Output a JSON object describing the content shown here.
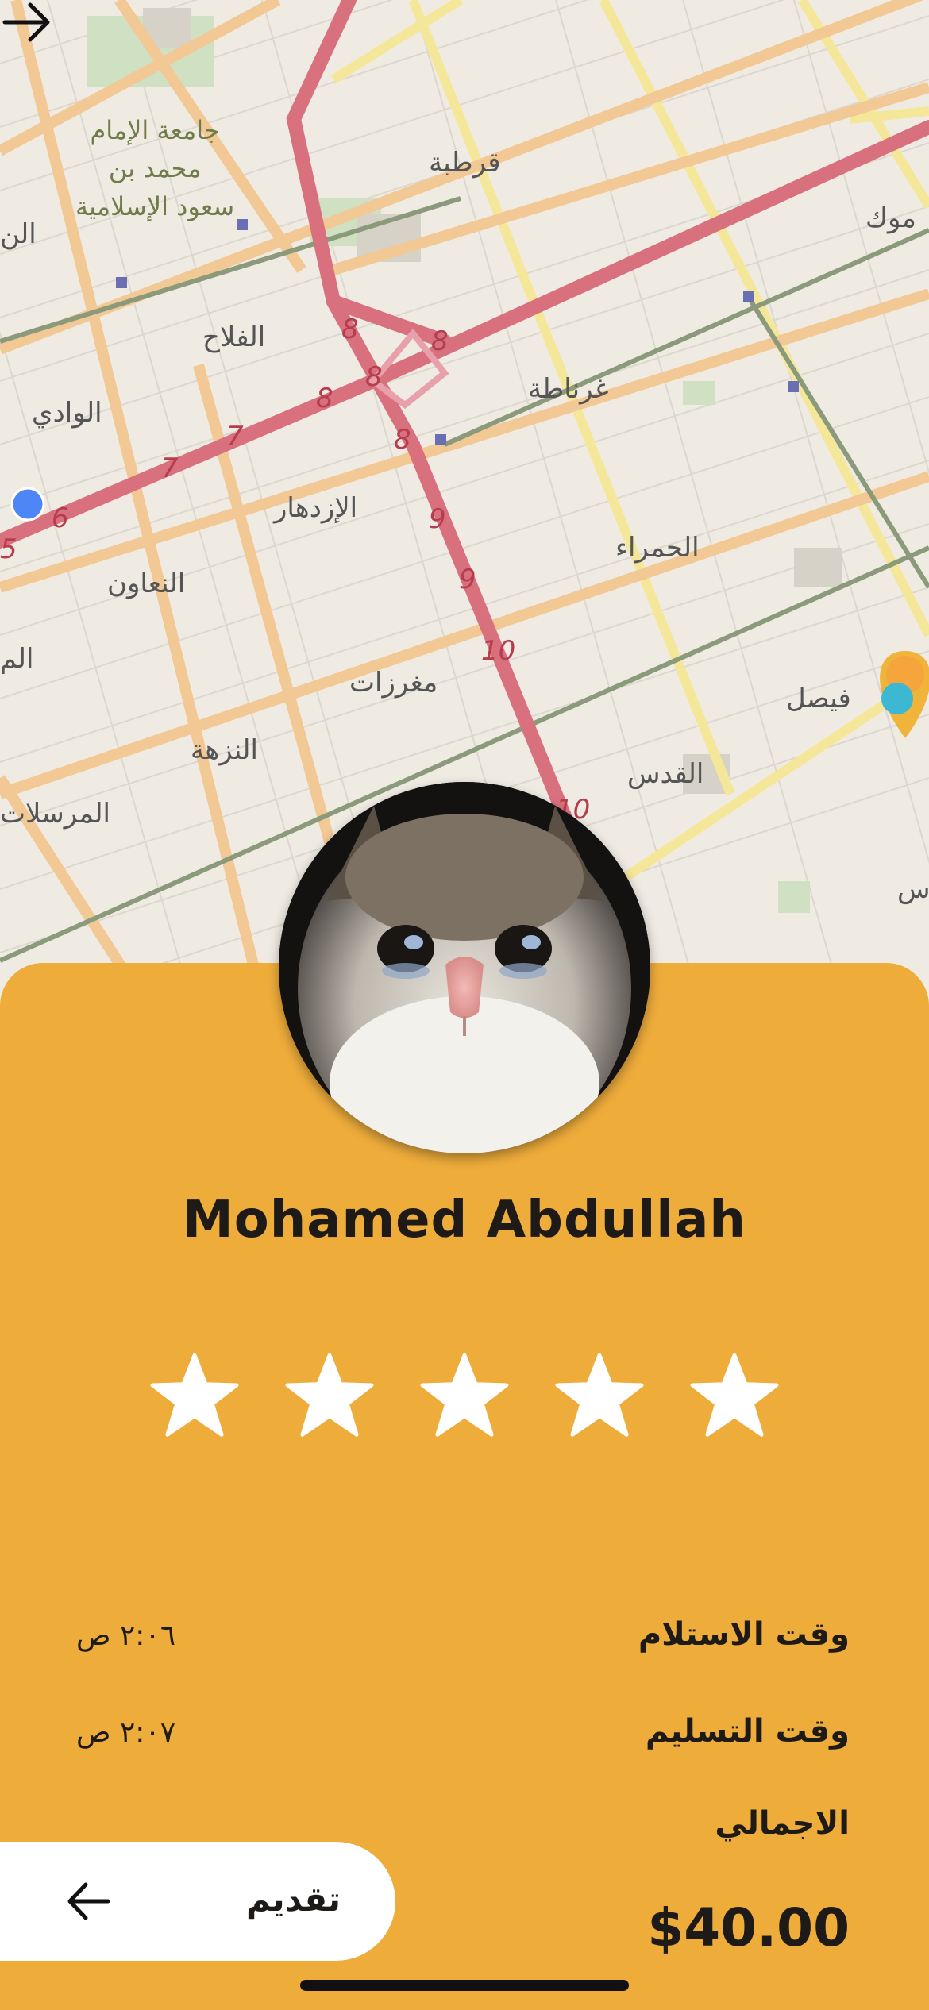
{
  "map": {
    "labels": [
      "جامعة الإمام",
      "محمد بن",
      "سعود الإسلامية",
      "قرطبة",
      "الفلاح",
      "الوادي",
      "غرناطة",
      "الإزدهار",
      "النعاون",
      "الحمراء",
      "مغرزات",
      "فيصل",
      "النزهة",
      "القدس",
      "المرسلات",
      "موك",
      "الن",
      "الم",
      "س"
    ],
    "route_numbers": [
      "8",
      "8",
      "8",
      "8",
      "8",
      "7",
      "7",
      "6",
      "5",
      "9",
      "9",
      "10",
      "10"
    ]
  },
  "header": {
    "back_icon": "arrow-right-icon"
  },
  "profile": {
    "name": "Mohamed Abdullah",
    "avatar": "crying-cat-photo",
    "rating": {
      "value": 5,
      "max": 5
    }
  },
  "details": {
    "pickup_label": "وقت الاستلام",
    "pickup_value": "٢:٠٦ ص",
    "delivery_label": "وقت التسليم",
    "delivery_value": "٢:٠٧ ص",
    "total_label": "الاجمالي",
    "total_value": "$40.00"
  },
  "submit": {
    "label": "تقديم",
    "icon": "arrow-left-icon"
  },
  "colors": {
    "sheet": "#eeac3b",
    "route": "#d9707e",
    "text": "#1e1a17"
  }
}
